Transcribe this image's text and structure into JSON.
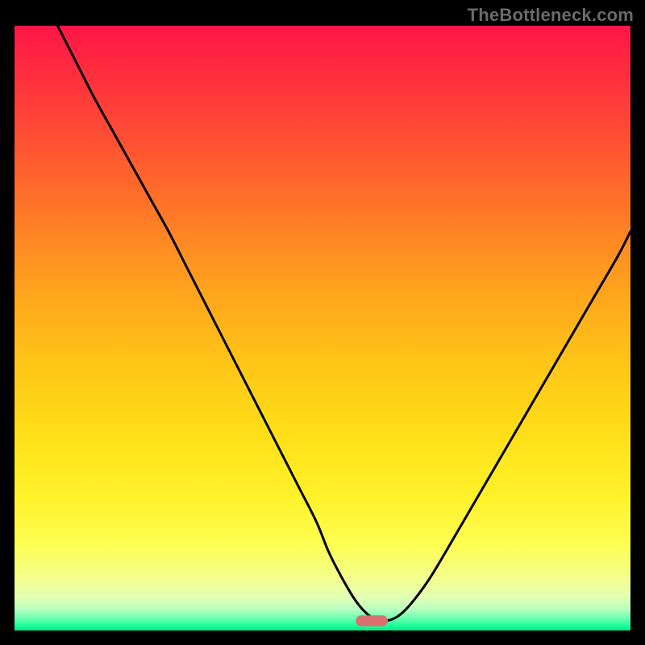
{
  "watermark": "TheBottleneck.com",
  "chart_data": {
    "type": "line",
    "title": "",
    "xlabel": "",
    "ylabel": "",
    "xlim": [
      0,
      100
    ],
    "ylim": [
      0,
      100
    ],
    "background_gradient": {
      "stops": [
        {
          "offset": 0.0,
          "color": "#ff1646"
        },
        {
          "offset": 0.08,
          "color": "#ff2e3e"
        },
        {
          "offset": 0.18,
          "color": "#ff4d34"
        },
        {
          "offset": 0.3,
          "color": "#ff7528"
        },
        {
          "offset": 0.42,
          "color": "#ff9e1e"
        },
        {
          "offset": 0.55,
          "color": "#ffc317"
        },
        {
          "offset": 0.68,
          "color": "#ffe019"
        },
        {
          "offset": 0.78,
          "color": "#fff22a"
        },
        {
          "offset": 0.86,
          "color": "#fdff54"
        },
        {
          "offset": 0.91,
          "color": "#f4ff8a"
        },
        {
          "offset": 0.945,
          "color": "#e3ffb3"
        },
        {
          "offset": 0.965,
          "color": "#b7ffc2"
        },
        {
          "offset": 0.98,
          "color": "#6affad"
        },
        {
          "offset": 0.992,
          "color": "#1cff9a"
        },
        {
          "offset": 1.0,
          "color": "#00e884"
        }
      ]
    },
    "series": [
      {
        "name": "bottleneck-curve",
        "color": "#000000",
        "x": [
          7,
          10,
          13,
          16,
          19,
          22,
          25,
          28,
          31,
          34,
          37,
          40,
          43,
          46,
          49,
          51,
          53,
          55,
          56.5,
          58,
          60,
          62,
          64,
          67,
          70,
          74,
          78,
          82,
          86,
          90,
          94,
          98,
          100
        ],
        "y": [
          100,
          94,
          88,
          82.5,
          77,
          71.5,
          66,
          60,
          54,
          48,
          42,
          36,
          30,
          24,
          18,
          13,
          9,
          5.5,
          3.5,
          2.2,
          1.6,
          2.2,
          4,
          8,
          13,
          20,
          27,
          34,
          41,
          48,
          55,
          62,
          66
        ]
      }
    ],
    "marker": {
      "name": "optimal-point",
      "x": 58,
      "y": 1.6,
      "width_pct": 5.2,
      "height_pct": 1.8,
      "color": "#d9706f"
    }
  }
}
